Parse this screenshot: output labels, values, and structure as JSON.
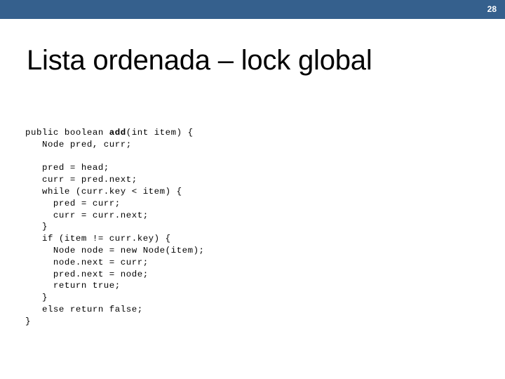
{
  "slide": {
    "number": "28",
    "title": "Lista ordenada – lock global",
    "accent_color": "#35608D",
    "background_color": "#FFFFFF",
    "text_color": "#000000"
  },
  "code": {
    "language": "java",
    "bold_token": "add",
    "lines": [
      "public boolean ",
      "   Node pred, curr;",
      "",
      "   pred = head;",
      "   curr = pred.next;",
      "   while (curr.key < item) {",
      "     pred = curr;",
      "     curr = curr.next;",
      "   }",
      "   if (item != curr.key) {",
      "     Node node = new Node(item);",
      "     node.next = curr;",
      "     pred.next = node;",
      "     return true;",
      "   }",
      "   else return false;",
      "}"
    ],
    "line_1_prefix": "public boolean ",
    "line_1_suffix": "(int item) {",
    "full_text": "public boolean add(int item) {\n   Node pred, curr;\n\n   pred = head;\n   curr = pred.next;\n   while (curr.key < item) {\n     pred = curr;\n     curr = curr.next;\n   }\n   if (item != curr.key) {\n     Node node = new Node(item);\n     node.next = curr;\n     pred.next = node;\n     return true;\n   }\n   else return false;\n}"
  }
}
